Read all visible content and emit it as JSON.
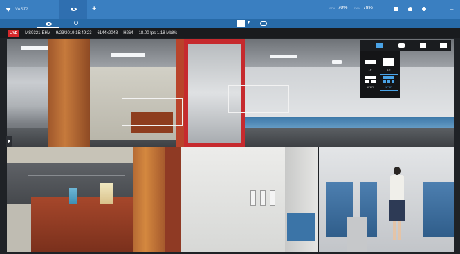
{
  "app": {
    "tab_name": "VAST2"
  },
  "topbar": {
    "cpu_label": "CPU",
    "cpu_value": "70%",
    "ram_label": "RAM",
    "ram_value": "78%"
  },
  "info_bar": {
    "live_badge": "LIVE",
    "camera": "MS9321-EHV",
    "datetime": "9/23/2019 15:49:23",
    "resolution": "6144x2048",
    "codec": "H264",
    "stats": "18.00 fps 1.18 Mbit/s"
  },
  "layout_menu": {
    "options": [
      {
        "label": "1P"
      },
      {
        "label": "1R"
      },
      {
        "label": "1P2R"
      },
      {
        "label": "1P3R"
      }
    ],
    "selected": "1P3R"
  },
  "colors": {
    "topbar": "#3a7fc1",
    "toolbar": "#276aa8",
    "live_badge": "#d6282b",
    "accent": "#4aa3e6"
  },
  "icons": [
    "app-logo-icon",
    "eye-icon",
    "add-tab-icon",
    "grid-icon",
    "bell-icon",
    "gear-icon",
    "search-icon",
    "layout-icon",
    "link-icon",
    "camera-icon",
    "snapshot-icon",
    "fisheye-icon"
  ]
}
